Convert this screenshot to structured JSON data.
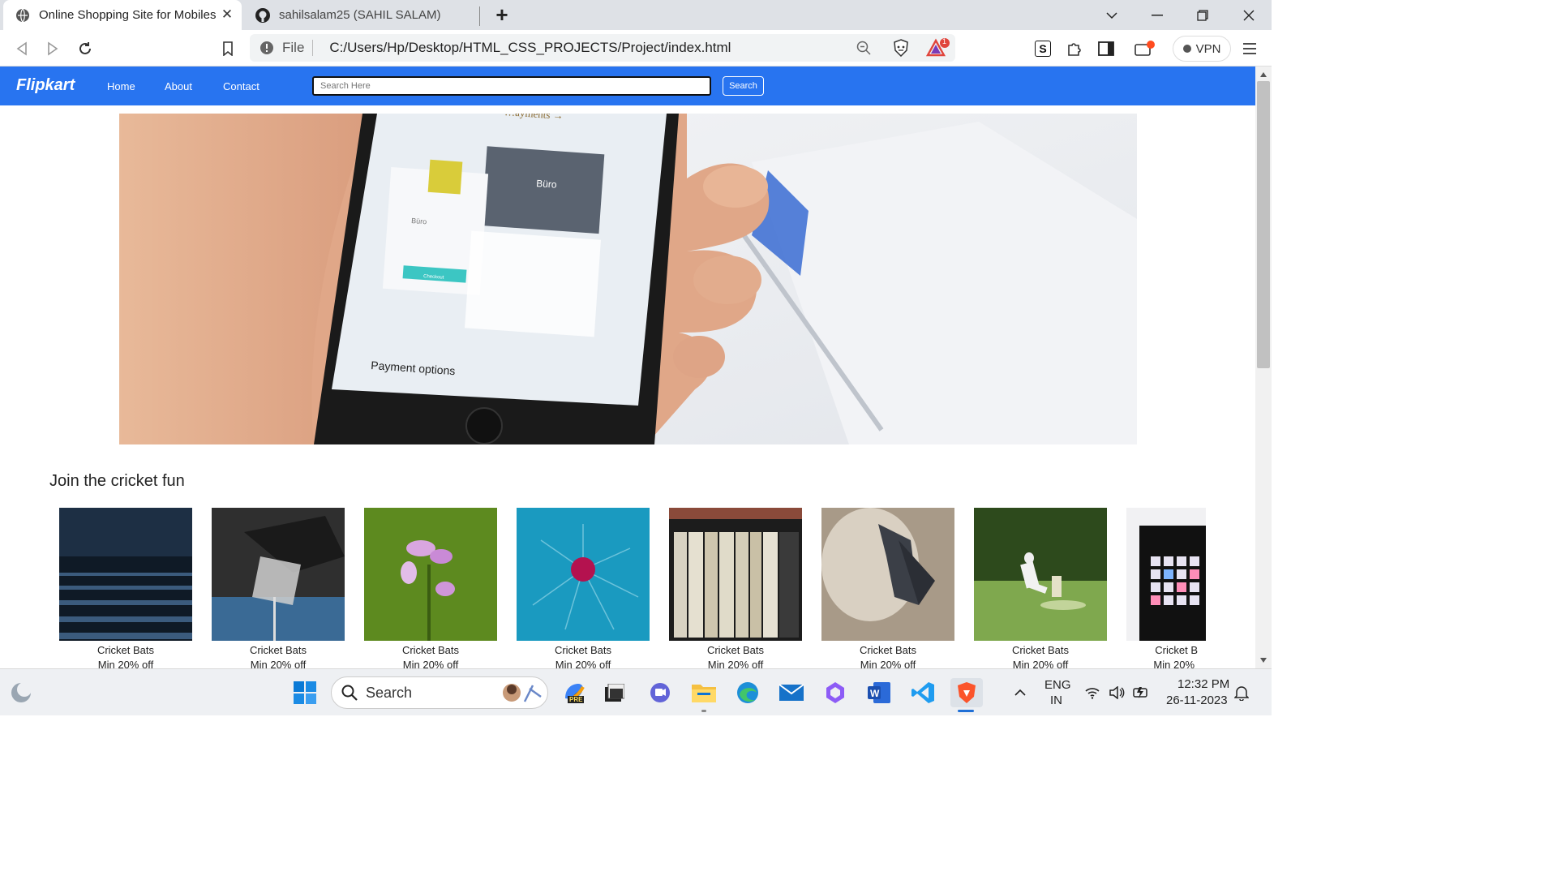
{
  "browser": {
    "tabs": [
      {
        "title": "Online Shopping Site for Mobiles",
        "active": true
      },
      {
        "title": "sahilsalam25 (SAHIL SALAM)",
        "active": false
      }
    ],
    "new_tab_label": "+",
    "address": {
      "scheme_label": "File",
      "url": "C:/Users/Hp/Desktop/HTML_CSS_PROJECTS/Project/index.html"
    },
    "brave_rewards_badge": "1",
    "vpn_label": "VPN",
    "extension_label": "S"
  },
  "site": {
    "logo": "Flipkart",
    "nav": [
      "Home",
      "About",
      "Contact"
    ],
    "search_placeholder": "Search Here",
    "search_button": "Search",
    "hero_text": {
      "top": "…ayments →",
      "brand": "Büro",
      "left_brand": "Büro",
      "checkout": "Checkout",
      "bottom": "Payment options"
    },
    "section_title": "Join the cricket fun",
    "products": [
      {
        "name": "Cricket Bats",
        "discount": "Min 20% off",
        "image": "stadium-seats"
      },
      {
        "name": "Cricket Bats",
        "discount": "Min 20% off",
        "image": "pouring-glass"
      },
      {
        "name": "Cricket Bats",
        "discount": "Min 20% off",
        "image": "purple-flower"
      },
      {
        "name": "Cricket Bats",
        "discount": "Min 20% off",
        "image": "red-ball"
      },
      {
        "name": "Cricket Bats",
        "discount": "Min 20% off",
        "image": "bookshelf"
      },
      {
        "name": "Cricket Bats",
        "discount": "Min 20% off",
        "image": "bat-animal"
      },
      {
        "name": "Cricket Bats",
        "discount": "Min 20% off",
        "image": "cricket-player"
      },
      {
        "name": "Cricket B",
        "discount": "Min 20%",
        "image": "launchpad"
      }
    ]
  },
  "taskbar": {
    "search_label": "Search",
    "language": "ENG",
    "region": "IN",
    "time": "12:32 PM",
    "date": "26-11-2023",
    "copilot_badge": "PRE"
  },
  "colors": {
    "brand_blue": "#2874f0",
    "tabstrip": "#dee1e6",
    "taskbar": "#eef0f3"
  }
}
